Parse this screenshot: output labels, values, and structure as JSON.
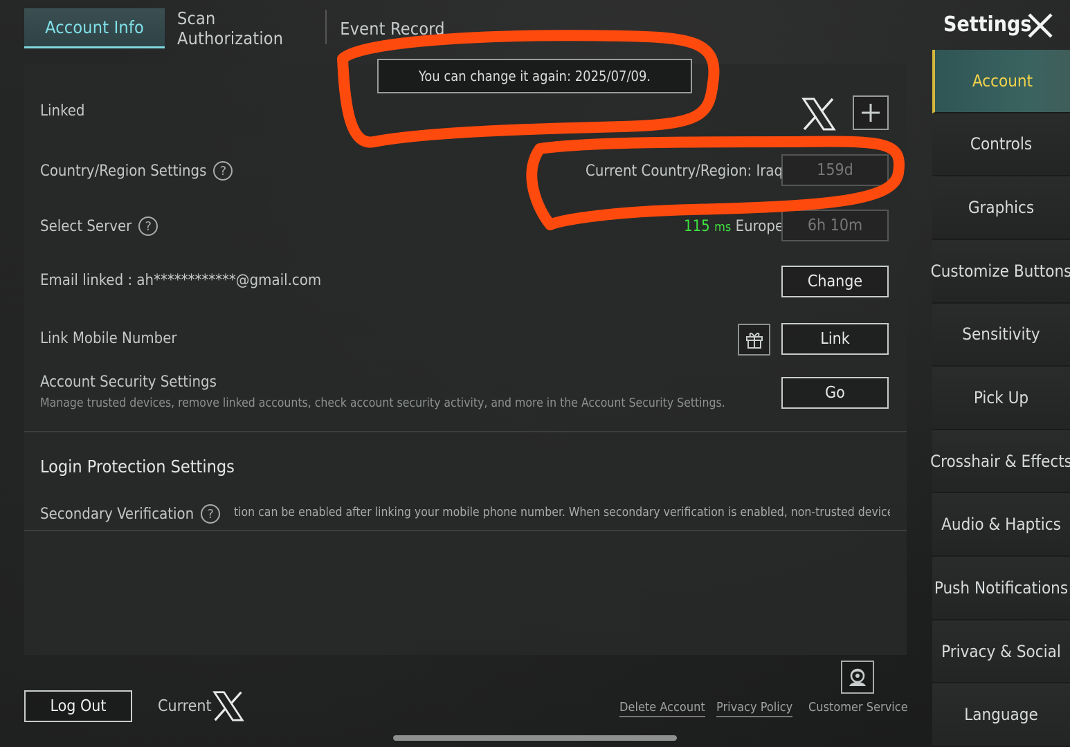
{
  "tabs": [
    {
      "label": "Account Info",
      "active": true
    },
    {
      "label": "Scan Authorization",
      "active": false
    },
    {
      "label": "Event Record",
      "active": false
    }
  ],
  "tooltip": "You can change it again: 2025/07/09.",
  "rows": {
    "linked": {
      "label": "Linked"
    },
    "country": {
      "label": "Country/Region Settings",
      "current": "Current Country/Region: Iraq",
      "cooldown": "159d"
    },
    "server": {
      "label": "Select Server",
      "ping_value": "115",
      "ping_unit": "ms",
      "server_name": "Europe",
      "cooldown": "6h 10m"
    },
    "email": {
      "label": "Email linked : ah************@gmail.com",
      "button": "Change"
    },
    "mobile": {
      "label": "Link Mobile Number",
      "button": "Link"
    },
    "security": {
      "label": "Account Security Settings",
      "description": "Manage trusted devices, remove linked accounts, check account security activity, and more in the Account Security Settings.",
      "button": "Go"
    }
  },
  "login_protection": {
    "title": "Login Protection Settings",
    "secondary_label": "Secondary Verification",
    "secondary_text": "tion can be enabled after linking your mobile phone number. When secondary verification is enabled, non-trusted devices ar"
  },
  "settings": {
    "title": "Settings",
    "items": [
      {
        "label": "Account",
        "active": true
      },
      {
        "label": "Controls"
      },
      {
        "label": "Graphics"
      },
      {
        "label": "Customize Buttons"
      },
      {
        "label": "Sensitivity"
      },
      {
        "label": "Pick Up"
      },
      {
        "label": "Crosshair & Effects"
      },
      {
        "label": "Audio & Haptics"
      },
      {
        "label": "Push Notifications"
      },
      {
        "label": "Privacy & Social"
      },
      {
        "label": "Language"
      }
    ]
  },
  "footer": {
    "logout": "Log Out",
    "current": "Current",
    "delete_account": "Delete Account",
    "privacy_policy": "Privacy Policy",
    "customer_service": "Customer Service"
  },
  "colors": {
    "accent_cyan": "#7fe0e8",
    "active_yellow": "#f4d44a",
    "ping_green": "#3fe33f",
    "annotation_red": "#ff4a0d"
  },
  "icons": [
    "x-logo-icon",
    "plus-icon",
    "help-icon",
    "gift-icon",
    "close-icon",
    "customer-service-icon"
  ]
}
